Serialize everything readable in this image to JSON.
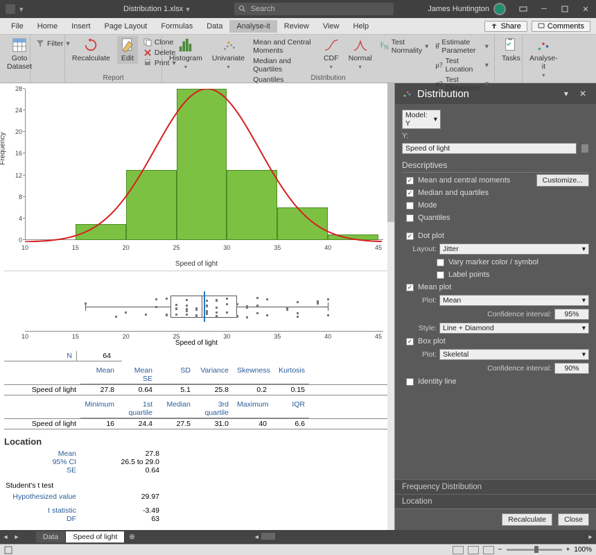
{
  "title": {
    "filename": "Distribution 1.xlsx",
    "search_placeholder": "Search",
    "user": "James Huntington"
  },
  "tabs": [
    "File",
    "Home",
    "Insert",
    "Page Layout",
    "Formulas",
    "Data",
    "Analyse-it",
    "Review",
    "View",
    "Help"
  ],
  "share": "Share",
  "comments": "Comments",
  "ribbon": {
    "goto": "Goto Dataset",
    "filter": "Filter",
    "recalc": "Recalculate",
    "edit": "Edit",
    "clone": "Clone",
    "delete": "Delete",
    "print": "Print",
    "histogram": "Histogram",
    "univariate": "Univariate",
    "mean_moments": "Mean and Central Moments",
    "median_quartiles": "Median and Quartiles",
    "quantiles": "Quantiles",
    "cdf": "CDF",
    "normal": "Normal",
    "test_normality": "Test Normality",
    "est_param": "Estimate Parameter",
    "test_location": "Test Location",
    "test_dispersion": "Test Dispersion",
    "tasks": "Tasks",
    "analyseit": "Analyse-it",
    "group_report": "Report",
    "group_distribution": "Distribution"
  },
  "chart_data": {
    "type": "bar",
    "xlabel": "Speed of light",
    "ylabel": "Frequency",
    "x_ticks": [
      10,
      15,
      20,
      25,
      30,
      35,
      40,
      45
    ],
    "y_ticks": [
      0,
      4,
      8,
      12,
      16,
      20,
      24,
      28
    ],
    "bin_edges": [
      15,
      20,
      25,
      30,
      35,
      40,
      45
    ],
    "values": [
      3,
      13,
      28,
      13,
      6,
      1
    ],
    "ylim": [
      0,
      28
    ],
    "xlim": [
      10,
      45
    ],
    "overlay": "normal_curve"
  },
  "boxplot_xlabel": "Speed of light",
  "stats_n": {
    "label": "N",
    "value": "64"
  },
  "stats1": {
    "headers": [
      "Mean",
      "Mean SE",
      "SD",
      "Variance",
      "Skewness",
      "Kurtosis"
    ],
    "rowlabel": "Speed of light",
    "values": [
      "27.8",
      "0.64",
      "5.1",
      "25.8",
      "0.2",
      "0.15"
    ]
  },
  "stats2": {
    "headers": [
      "Minimum",
      "1st quartile",
      "Median",
      "3rd quartile",
      "Maximum",
      "IQR"
    ],
    "rowlabel": "Speed of light",
    "values": [
      "16",
      "24.4",
      "27.5",
      "31.0",
      "40",
      "6.6"
    ]
  },
  "location": {
    "title": "Location",
    "mean_k": "Mean",
    "mean_v": "27.8",
    "ci_k": "95% CI",
    "ci_v": "26.5 to 29.0",
    "se_k": "SE",
    "se_v": "0.64",
    "ttest": "Student's t test",
    "hyp_k": "Hypothesized value",
    "hyp_v": "29.97",
    "tstat_k": "t statistic",
    "tstat_v": "-3.49",
    "df_k": "DF",
    "df_v": "63"
  },
  "panel": {
    "title": "Distribution",
    "model": "Model: Y",
    "y_label": "Y:",
    "y_value": "Speed of light",
    "descriptives": "Descriptives",
    "customize": "Customize...",
    "mean_moments": "Mean and central moments",
    "median_quartiles": "Median and quartiles",
    "mode": "Mode",
    "quantiles": "Quantiles",
    "dotplot": "Dot plot",
    "layout": "Layout:",
    "jitter": "Jitter",
    "vary_marker": "Vary marker color / symbol",
    "label_points": "Label points",
    "meanplot": "Mean plot",
    "plot": "Plot:",
    "mean": "Mean",
    "ci": "Confidence interval:",
    "ci95": "95%",
    "style": "Style:",
    "line_diamond": "Line + Diamond",
    "boxplot": "Box plot",
    "skeletal": "Skeletal",
    "ci90": "90%",
    "identity": "Identity line",
    "freq_dist": "Frequency Distribution",
    "location": "Location",
    "recalculate": "Recalculate",
    "close": "Close"
  },
  "sheets": {
    "s1": "Data",
    "s2": "Speed of light"
  },
  "zoom": "100%"
}
